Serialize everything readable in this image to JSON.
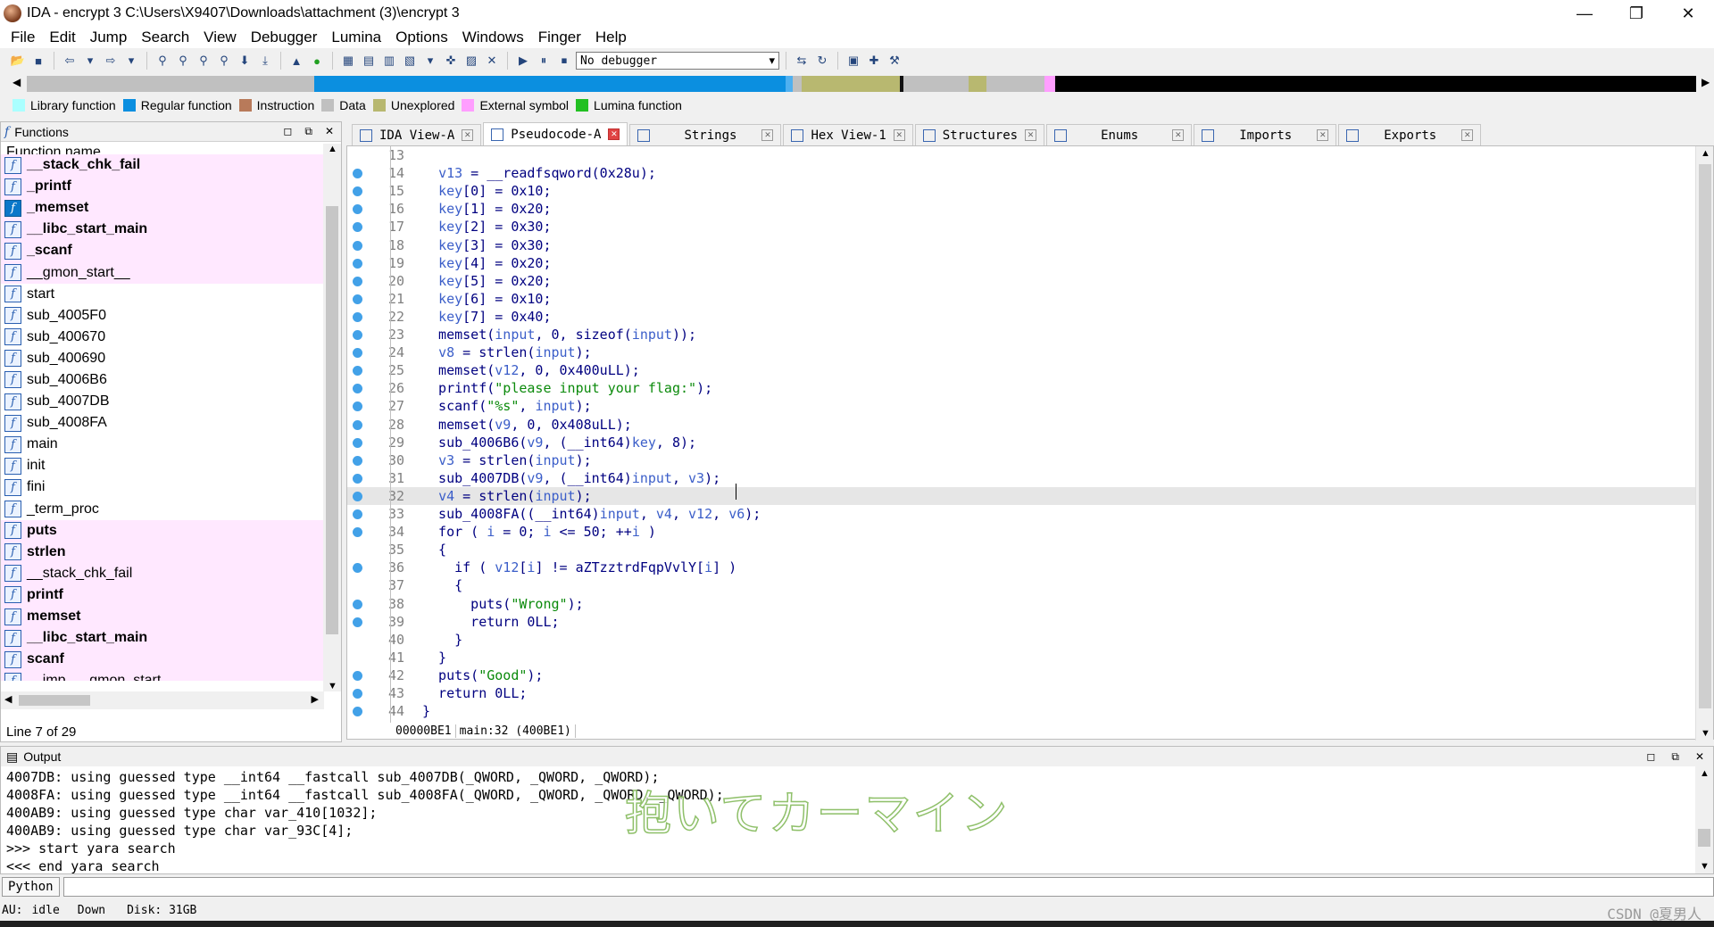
{
  "window": {
    "title": "IDA - encrypt 3 C:\\Users\\X9407\\Downloads\\attachment (3)\\encrypt 3",
    "minimize": "—",
    "maximize": "❐",
    "close": "✕"
  },
  "menu": [
    "File",
    "Edit",
    "Jump",
    "Search",
    "View",
    "Debugger",
    "Lumina",
    "Options",
    "Windows",
    "Finger",
    "Help"
  ],
  "toolbar": {
    "debugger": "No debugger"
  },
  "legend": [
    {
      "label": "Library function",
      "color": "#aaffff"
    },
    {
      "label": "Regular function",
      "color": "#0b8fe0"
    },
    {
      "label": "Instruction",
      "color": "#b87a5a"
    },
    {
      "label": "Data",
      "color": "#c0c0c0"
    },
    {
      "label": "Unexplored",
      "color": "#b8b870"
    },
    {
      "label": "External symbol",
      "color": "#ff9eff"
    },
    {
      "label": "Lumina function",
      "color": "#22c022"
    }
  ],
  "functions": {
    "title": "Functions",
    "header": "Function name",
    "status": "Line 7 of 29",
    "items": [
      {
        "name": "__stack_chk_fail",
        "lib": true,
        "bold": true,
        "blue": false
      },
      {
        "name": "_printf",
        "lib": true,
        "bold": true,
        "blue": false
      },
      {
        "name": "_memset",
        "lib": true,
        "bold": true,
        "blue": true
      },
      {
        "name": "__libc_start_main",
        "lib": true,
        "bold": true,
        "blue": false
      },
      {
        "name": "_scanf",
        "lib": true,
        "bold": true,
        "blue": false
      },
      {
        "name": "__gmon_start__",
        "lib": true,
        "bold": false,
        "blue": false
      },
      {
        "name": "start",
        "lib": false,
        "bold": false,
        "blue": false
      },
      {
        "name": "sub_4005F0",
        "lib": false,
        "bold": false,
        "blue": false
      },
      {
        "name": "sub_400670",
        "lib": false,
        "bold": false,
        "blue": false
      },
      {
        "name": "sub_400690",
        "lib": false,
        "bold": false,
        "blue": false
      },
      {
        "name": "sub_4006B6",
        "lib": false,
        "bold": false,
        "blue": false
      },
      {
        "name": "sub_4007DB",
        "lib": false,
        "bold": false,
        "blue": false
      },
      {
        "name": "sub_4008FA",
        "lib": false,
        "bold": false,
        "blue": false
      },
      {
        "name": "main",
        "lib": false,
        "bold": false,
        "blue": false
      },
      {
        "name": "init",
        "lib": false,
        "bold": false,
        "blue": false
      },
      {
        "name": "fini",
        "lib": false,
        "bold": false,
        "blue": false
      },
      {
        "name": "_term_proc",
        "lib": false,
        "bold": false,
        "blue": false
      },
      {
        "name": "puts",
        "lib": true,
        "bold": true,
        "blue": false
      },
      {
        "name": "strlen",
        "lib": true,
        "bold": true,
        "blue": false
      },
      {
        "name": "__stack_chk_fail",
        "lib": true,
        "bold": false,
        "blue": false
      },
      {
        "name": "printf",
        "lib": true,
        "bold": true,
        "blue": false
      },
      {
        "name": "memset",
        "lib": true,
        "bold": true,
        "blue": false
      },
      {
        "name": "__libc_start_main",
        "lib": true,
        "bold": true,
        "blue": false
      },
      {
        "name": "scanf",
        "lib": true,
        "bold": true,
        "blue": false
      },
      {
        "name": "__imp___gmon_start__",
        "lib": true,
        "bold": false,
        "blue": false
      }
    ]
  },
  "tabs": [
    {
      "label": "IDA View-A",
      "active": false
    },
    {
      "label": "Pseudocode-A",
      "active": true
    },
    {
      "label": "Strings",
      "active": false
    },
    {
      "label": "Hex View-1",
      "active": false
    },
    {
      "label": "Structures",
      "active": false
    },
    {
      "label": "Enums",
      "active": false
    },
    {
      "label": "Imports",
      "active": false
    },
    {
      "label": "Exports",
      "active": false
    }
  ],
  "code": {
    "lines": [
      {
        "n": "13",
        "dot": false,
        "html": ""
      },
      {
        "n": "14",
        "dot": true,
        "html": "  <span class='v'>v13</span> = __readfsqword(0x28u);"
      },
      {
        "n": "15",
        "dot": true,
        "html": "  <span class='v'>key</span>[0] = 0x10;"
      },
      {
        "n": "16",
        "dot": true,
        "html": "  <span class='v'>key</span>[1] = 0x20;"
      },
      {
        "n": "17",
        "dot": true,
        "html": "  <span class='v'>key</span>[2] = 0x30;"
      },
      {
        "n": "18",
        "dot": true,
        "html": "  <span class='v'>key</span>[3] = 0x30;"
      },
      {
        "n": "19",
        "dot": true,
        "html": "  <span class='v'>key</span>[4] = 0x20;"
      },
      {
        "n": "20",
        "dot": true,
        "html": "  <span class='v'>key</span>[5] = 0x20;"
      },
      {
        "n": "21",
        "dot": true,
        "html": "  <span class='v'>key</span>[6] = 0x10;"
      },
      {
        "n": "22",
        "dot": true,
        "html": "  <span class='v'>key</span>[7] = 0x40;"
      },
      {
        "n": "23",
        "dot": true,
        "html": "  memset(<span class='v'>input</span>, 0, sizeof(<span class='v'>input</span>));"
      },
      {
        "n": "24",
        "dot": true,
        "html": "  <span class='v'>v8</span> = strlen(<span class='v'>input</span>);"
      },
      {
        "n": "25",
        "dot": true,
        "html": "  memset(<span class='v'>v12</span>, 0, 0x400uLL);"
      },
      {
        "n": "26",
        "dot": true,
        "html": "  printf(<span class='s'>\"please input your flag:\"</span>);"
      },
      {
        "n": "27",
        "dot": true,
        "html": "  scanf(<span class='s'>\"%s\"</span>, <span class='v'>input</span>);"
      },
      {
        "n": "28",
        "dot": true,
        "html": "  memset(<span class='v'>v9</span>, 0, 0x408uLL);"
      },
      {
        "n": "29",
        "dot": true,
        "html": "  sub_4006B6(<span class='v'>v9</span>, (__int64)<span class='v'>key</span>, 8);"
      },
      {
        "n": "30",
        "dot": true,
        "html": "  <span class='v'>v3</span> = strlen(<span class='v'>input</span>);"
      },
      {
        "n": "31",
        "dot": true,
        "html": "  sub_4007DB(<span class='v'>v9</span>, (__int64)<span class='v'>input</span>, <span class='v'>v3</span>);"
      },
      {
        "n": "32",
        "dot": true,
        "html": "  <span class='v'>v4</span> = strlen(<span class='v'>input</span>);",
        "current": true
      },
      {
        "n": "33",
        "dot": true,
        "html": "  sub_4008FA((__int64)<span class='v'>input</span>, <span class='v'>v4</span>, <span class='v'>v12</span>, <span class='v'>v6</span>);"
      },
      {
        "n": "34",
        "dot": true,
        "html": "  for ( <span class='v'>i</span> = 0; <span class='v'>i</span> <= 50; ++<span class='v'>i</span> )"
      },
      {
        "n": "35",
        "dot": false,
        "html": "  {"
      },
      {
        "n": "36",
        "dot": true,
        "html": "    if ( <span class='v'>v12</span>[<span class='v'>i</span>] != aZTzztrdFqpVvlY[<span class='v'>i</span>] )"
      },
      {
        "n": "37",
        "dot": false,
        "html": "    {"
      },
      {
        "n": "38",
        "dot": true,
        "html": "      puts(<span class='s'>\"Wrong\"</span>);"
      },
      {
        "n": "39",
        "dot": true,
        "html": "      return 0LL;"
      },
      {
        "n": "40",
        "dot": false,
        "html": "    }"
      },
      {
        "n": "41",
        "dot": false,
        "html": "  }"
      },
      {
        "n": "42",
        "dot": true,
        "html": "  puts(<span class='s'>\"Good\"</span>);"
      },
      {
        "n": "43",
        "dot": true,
        "html": "  return 0LL;"
      },
      {
        "n": "44",
        "dot": true,
        "html": "}"
      }
    ],
    "status_addr": "00000BE1",
    "status_loc": "main:32 (400BE1)"
  },
  "output": {
    "title": "Output",
    "lines": [
      "4007DB: using guessed type __int64 __fastcall sub_4007DB(_QWORD, _QWORD, _QWORD);",
      "4008FA: using guessed type __int64 __fastcall sub_4008FA(_QWORD, _QWORD, _QWORD, _QWORD);",
      "400AB9: using guessed type char var_410[1032];",
      "400AB9: using guessed type char var_93C[4];",
      ">>> start yara search",
      "<<< end yara search"
    ]
  },
  "watermark": "抱いてカーマイン",
  "python_button": "Python",
  "statusbar": {
    "au_label": "AU:",
    "au_state": "idle",
    "direction": "Down",
    "disk": "Disk: 31GB",
    "csdn": "CSDN @夏男人"
  }
}
